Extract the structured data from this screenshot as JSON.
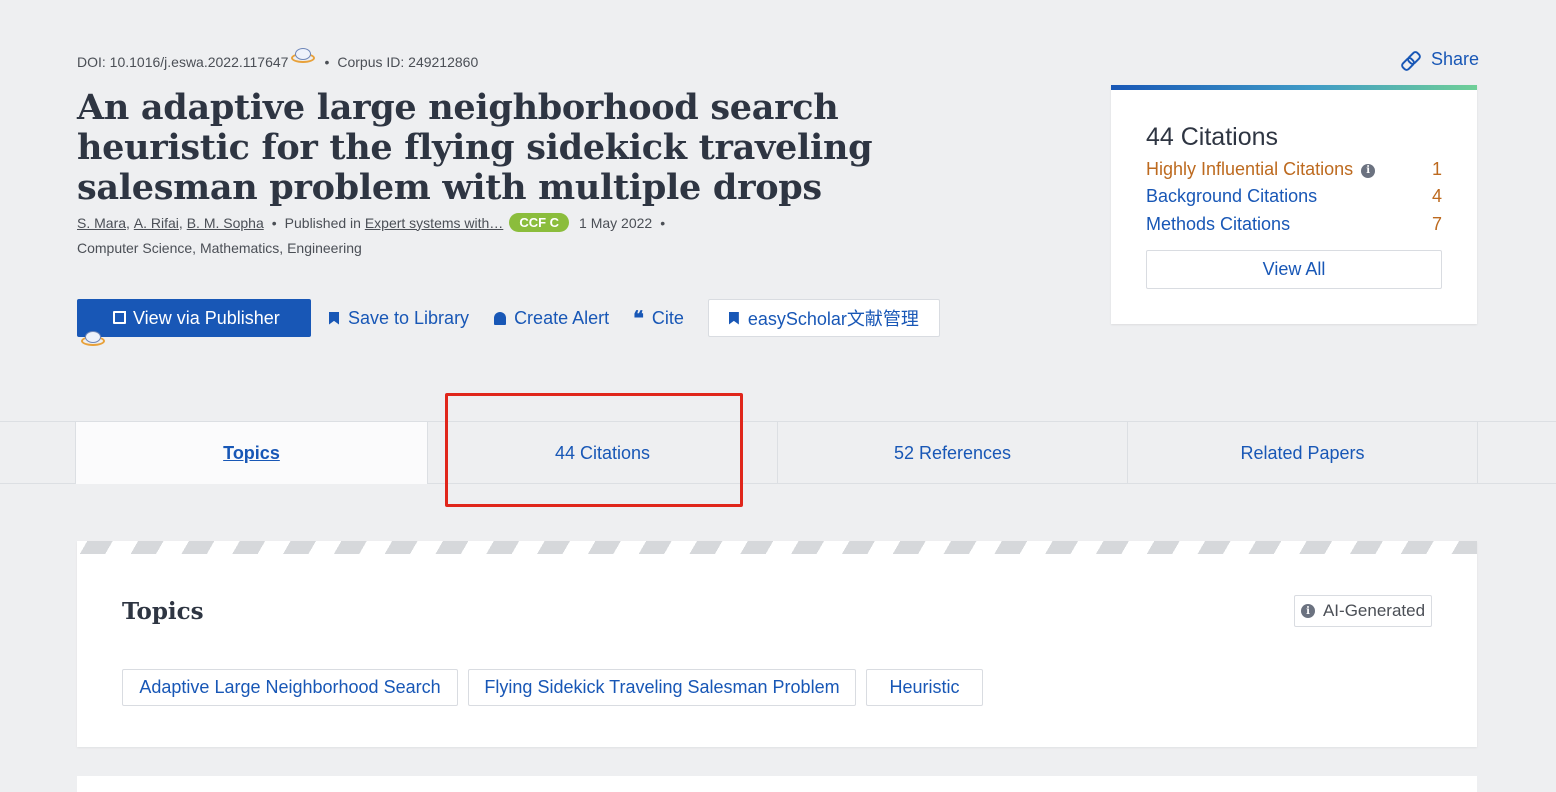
{
  "paper": {
    "doi": "DOI: 10.1016/j.eswa.2022.117647",
    "corpus_id": "Corpus ID: 249212860",
    "title": "An adaptive large neighborhood search heuristic for the flying sidekick traveling salesman problem with multiple drops",
    "authors": [
      "S. Mara",
      "A. Rifai",
      "B. M. Sopha"
    ],
    "published_in_label": "Published in",
    "venue": "Expert systems with…",
    "ccf_badge": "CCF C",
    "date": "1 May 2022",
    "fields": "Computer Science, Mathematics, Engineering"
  },
  "actions": {
    "view_publisher": "View via Publisher",
    "save_library": "Save to Library",
    "create_alert": "Create Alert",
    "cite": "Cite",
    "easyscholar": "easyScholar文献管理"
  },
  "share": "Share",
  "citations_card": {
    "heading": "44 Citations",
    "rows": [
      {
        "label": "Highly Influential Citations",
        "count": "1"
      },
      {
        "label": "Background Citations",
        "count": "4"
      },
      {
        "label": "Methods Citations",
        "count": "7"
      }
    ],
    "view_all": "View All"
  },
  "tabs": [
    {
      "label": "Topics",
      "active": true
    },
    {
      "label": "44 Citations",
      "active": false
    },
    {
      "label": "52 References",
      "active": false
    },
    {
      "label": "Related Papers",
      "active": false
    }
  ],
  "topics_section": {
    "heading": "Topics",
    "badge": "AI-Generated",
    "chips": [
      "Adaptive Large Neighborhood Search",
      "Flying Sidekick Traveling Salesman Problem",
      "Heuristic"
    ]
  },
  "colors": {
    "primary": "#1857b6",
    "highlight_box": "#e0261b",
    "influential": "#bd6a1f",
    "ccf_badge": "#8bbd3c"
  },
  "icons": [
    "easyscholar-logo-icon",
    "external-link-icon",
    "bookmark-icon",
    "bell-icon",
    "quote-icon",
    "link-icon",
    "info-icon"
  ]
}
